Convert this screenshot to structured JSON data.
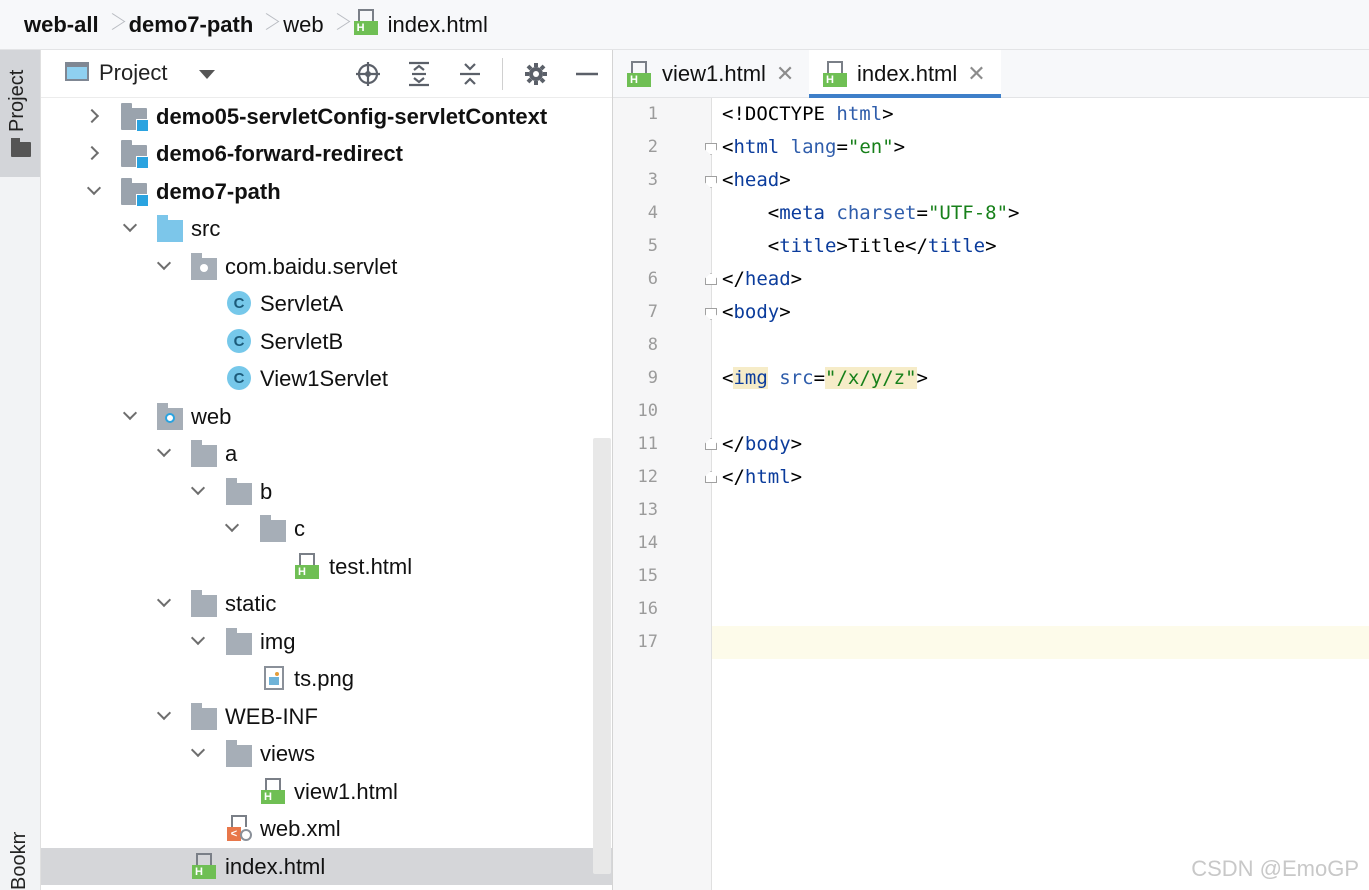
{
  "breadcrumb": [
    "web-all",
    "demo7-path",
    "web",
    "index.html"
  ],
  "stripe": {
    "project_label": "Project",
    "bookmarks_label": "Bookmarks"
  },
  "project_panel": {
    "title": "Project"
  },
  "tree": [
    {
      "label": "demo05-servletConfig-servletContext",
      "icon": "module-folder-icon",
      "expanded": false,
      "bold": true
    },
    {
      "label": "demo6-forward-redirect",
      "icon": "module-folder-icon",
      "expanded": false,
      "bold": true
    },
    {
      "label": "demo7-path",
      "icon": "module-folder-icon",
      "expanded": true,
      "bold": true
    },
    {
      "label": "src",
      "icon": "source-folder-icon",
      "expanded": true
    },
    {
      "label": "com.baidu.servlet",
      "icon": "package-icon",
      "expanded": true
    },
    {
      "label": "ServletA",
      "icon": "class-icon"
    },
    {
      "label": "ServletB",
      "icon": "class-icon"
    },
    {
      "label": "View1Servlet",
      "icon": "class-icon"
    },
    {
      "label": "web",
      "icon": "web-folder-icon",
      "expanded": true
    },
    {
      "label": "a",
      "icon": "folder-icon",
      "expanded": true
    },
    {
      "label": "b",
      "icon": "folder-icon",
      "expanded": true
    },
    {
      "label": "c",
      "icon": "folder-icon",
      "expanded": true
    },
    {
      "label": "test.html",
      "icon": "html-file-icon"
    },
    {
      "label": "static",
      "icon": "folder-icon",
      "expanded": true
    },
    {
      "label": "img",
      "icon": "folder-icon",
      "expanded": true
    },
    {
      "label": "ts.png",
      "icon": "image-file-icon"
    },
    {
      "label": "WEB-INF",
      "icon": "folder-icon",
      "expanded": true
    },
    {
      "label": "views",
      "icon": "folder-icon",
      "expanded": true
    },
    {
      "label": "view1.html",
      "icon": "html-file-icon"
    },
    {
      "label": "web.xml",
      "icon": "xml-file-icon"
    },
    {
      "label": "index.html",
      "icon": "html-file-icon",
      "selected": true
    }
  ],
  "tabs": [
    {
      "label": "view1.html",
      "active": false
    },
    {
      "label": "index.html",
      "active": true
    }
  ],
  "editor": {
    "current_line": 17,
    "lines": [
      "<!DOCTYPE html>",
      "<html lang=\"en\">",
      "<head>",
      "    <meta charset=\"UTF-8\">",
      "    <title>Title</title>",
      "</head>",
      "<body>",
      "",
      "<img src=\"/x/y/z\">",
      "",
      "</body>",
      "</html>",
      "",
      "",
      "",
      "",
      ""
    ]
  },
  "watermark": "CSDN @EmoGP",
  "colors": {
    "tag": "#0b3c9c",
    "attr": "#2f5dab",
    "string": "#17801a",
    "active_tab_underline": "#3e7fc9",
    "current_line": "#fdfbea"
  }
}
